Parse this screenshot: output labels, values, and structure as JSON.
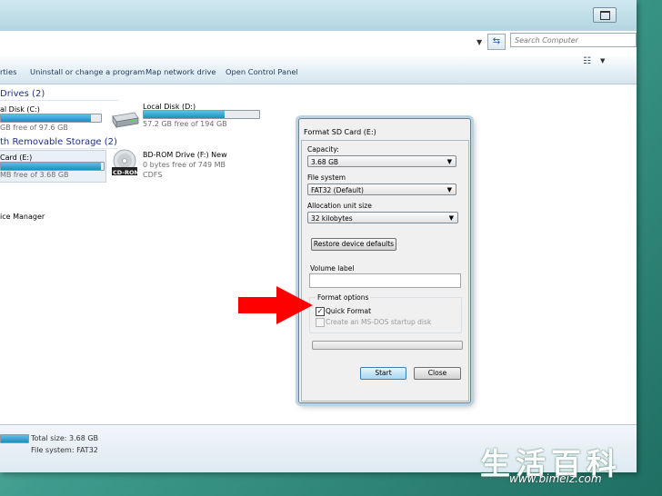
{
  "explorer": {
    "search_placeholder": "Search Computer",
    "toolbar": {
      "properties": "rties",
      "uninstall": "Uninstall or change a program",
      "map_drive": "Map network drive",
      "control_panel": "Open Control Panel"
    },
    "sections": {
      "hard_drives": "Drives (2)",
      "removable": "th Removable Storage (2)"
    },
    "drives": {
      "c": {
        "name": "al Disk (C:)",
        "free": "GB free of 97.6 GB",
        "used_fraction": 0.9
      },
      "d": {
        "name": "Local Disk (D:)",
        "free": "57.2 GB free of 194 GB",
        "used_fraction": 0.7
      },
      "e": {
        "name": "Card (E:)",
        "free": "MB free of 3.68 GB",
        "used_fraction": 0.97
      },
      "f": {
        "name": "BD-ROM Drive (F:) New",
        "free": "0 bytes free of 749 MB",
        "fs": "CDFS",
        "icon_label": "CD-ROM"
      }
    },
    "device_manager": "ice Manager",
    "details": {
      "total_size": "Total size: 3.68 GB",
      "file_system": "File system:  FAT32"
    }
  },
  "dialog": {
    "title": "Format SD Card (E:)",
    "capacity_label": "Capacity:",
    "capacity_value": "3.68 GB",
    "filesystem_label": "File system",
    "filesystem_value": "FAT32 (Default)",
    "alloc_label": "Allocation unit size",
    "alloc_value": "32 kilobytes",
    "restore_label": "Restore device defaults",
    "volume_label": "Volume label",
    "volume_value": "",
    "format_options_label": "Format options",
    "quick_format_label": "Quick Format",
    "quick_format_checked": true,
    "msdos_label": "Create an MS-DOS startup disk",
    "start_label": "Start",
    "close_label": "Close",
    "check_glyph": "✓"
  },
  "watermark": {
    "text": "生活百科",
    "url": "www.bimeiz.com"
  },
  "colors": {
    "section_blue": "#1e3287",
    "arrow_red": "#ff0000",
    "bar_fill": "#1e8fc0"
  }
}
